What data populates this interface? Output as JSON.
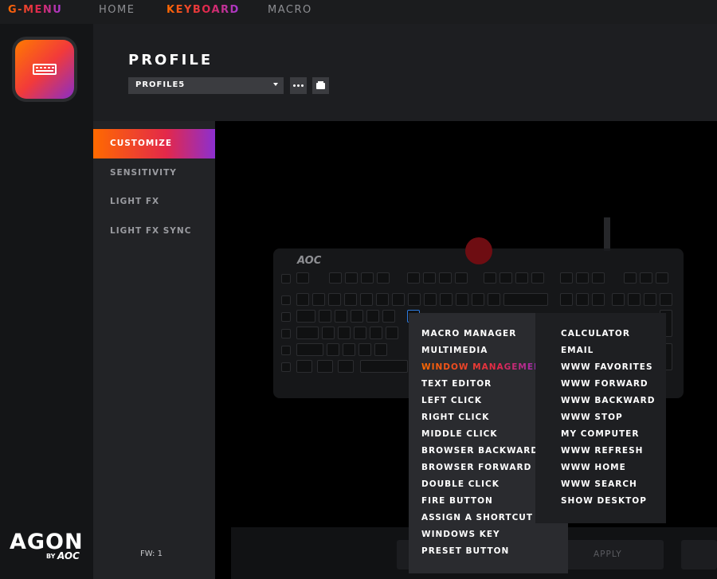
{
  "nav": {
    "brand": "G-MENU",
    "home": "HOME",
    "keyboard": "KEYBOARD",
    "macro": "MACRO"
  },
  "brand": {
    "logo": "AGON",
    "by": "BY",
    "maker": "AOC"
  },
  "header": {
    "title": "PROFILE",
    "profile_select_value": "PROFILE5"
  },
  "sidebar": {
    "items": [
      {
        "label": "CUSTOMIZE",
        "active": true
      },
      {
        "label": "SENSITIVITY",
        "active": false
      },
      {
        "label": "LIGHT FX",
        "active": false
      },
      {
        "label": "LIGHT FX SYNC",
        "active": false
      }
    ],
    "firmware": "FW: 1"
  },
  "keyboard": {
    "logo": "AOC"
  },
  "footer": {
    "apply_label": "APPLY"
  },
  "dropdown": {
    "main_items": [
      "MACRO MANAGER",
      "MULTIMEDIA",
      "WINDOW MANAGEMENT",
      "TEXT EDITOR",
      "LEFT CLICK",
      "RIGHT CLICK",
      "MIDDLE CLICK",
      "BROWSER BACKWARD",
      "BROWSER FORWARD",
      "DOUBLE CLICK",
      "FIRE BUTTON",
      "ASSIGN A SHORTCUT",
      "WINDOWS KEY",
      "PRESET BUTTON"
    ],
    "highlighted": "WINDOW MANAGEMENT",
    "sub_items": [
      "CALCULATOR",
      "EMAIL",
      "WWW FAVORITES",
      "WWW FORWARD",
      "WWW BACKWARD",
      "WWW STOP",
      "MY COMPUTER",
      "WWW REFRESH",
      "WWW HOME",
      "WWW SEARCH",
      "SHOW DESKTOP"
    ]
  },
  "colors": {
    "accent_orange": "#ff6a00",
    "accent_red": "#e3284a",
    "accent_purple": "#8c2fd0",
    "selected_key_outline": "#2d7be0"
  }
}
